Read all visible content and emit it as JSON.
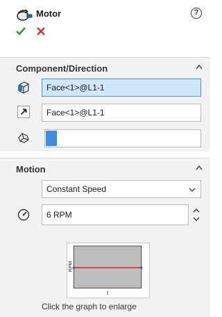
{
  "header": {
    "title": "Motor",
    "icons": {
      "motor": "motor-icon",
      "help": "help-icon",
      "ok": "checkmark-icon",
      "cancel": "cancel-x-icon"
    },
    "help_label": "?"
  },
  "component_direction": {
    "title": "Component/Direction",
    "component_field": "Face<1>@L1-1",
    "direction_field": "Face<1>@L1-1",
    "progress_fraction": 0.07
  },
  "motion": {
    "title": "Motion",
    "type_selected": "Constant Speed",
    "speed_value": "6 RPM",
    "graph": {
      "ylabel": "RPM",
      "xlabel": "t"
    },
    "graph_caption": "Click the graph to enlarge"
  },
  "colors": {
    "accent": "#3c8de0",
    "ok_green": "#2f9b3a",
    "cancel_red": "#d6312b",
    "graph_line": "#e01515",
    "graph_fill": "#bdbdbd"
  }
}
